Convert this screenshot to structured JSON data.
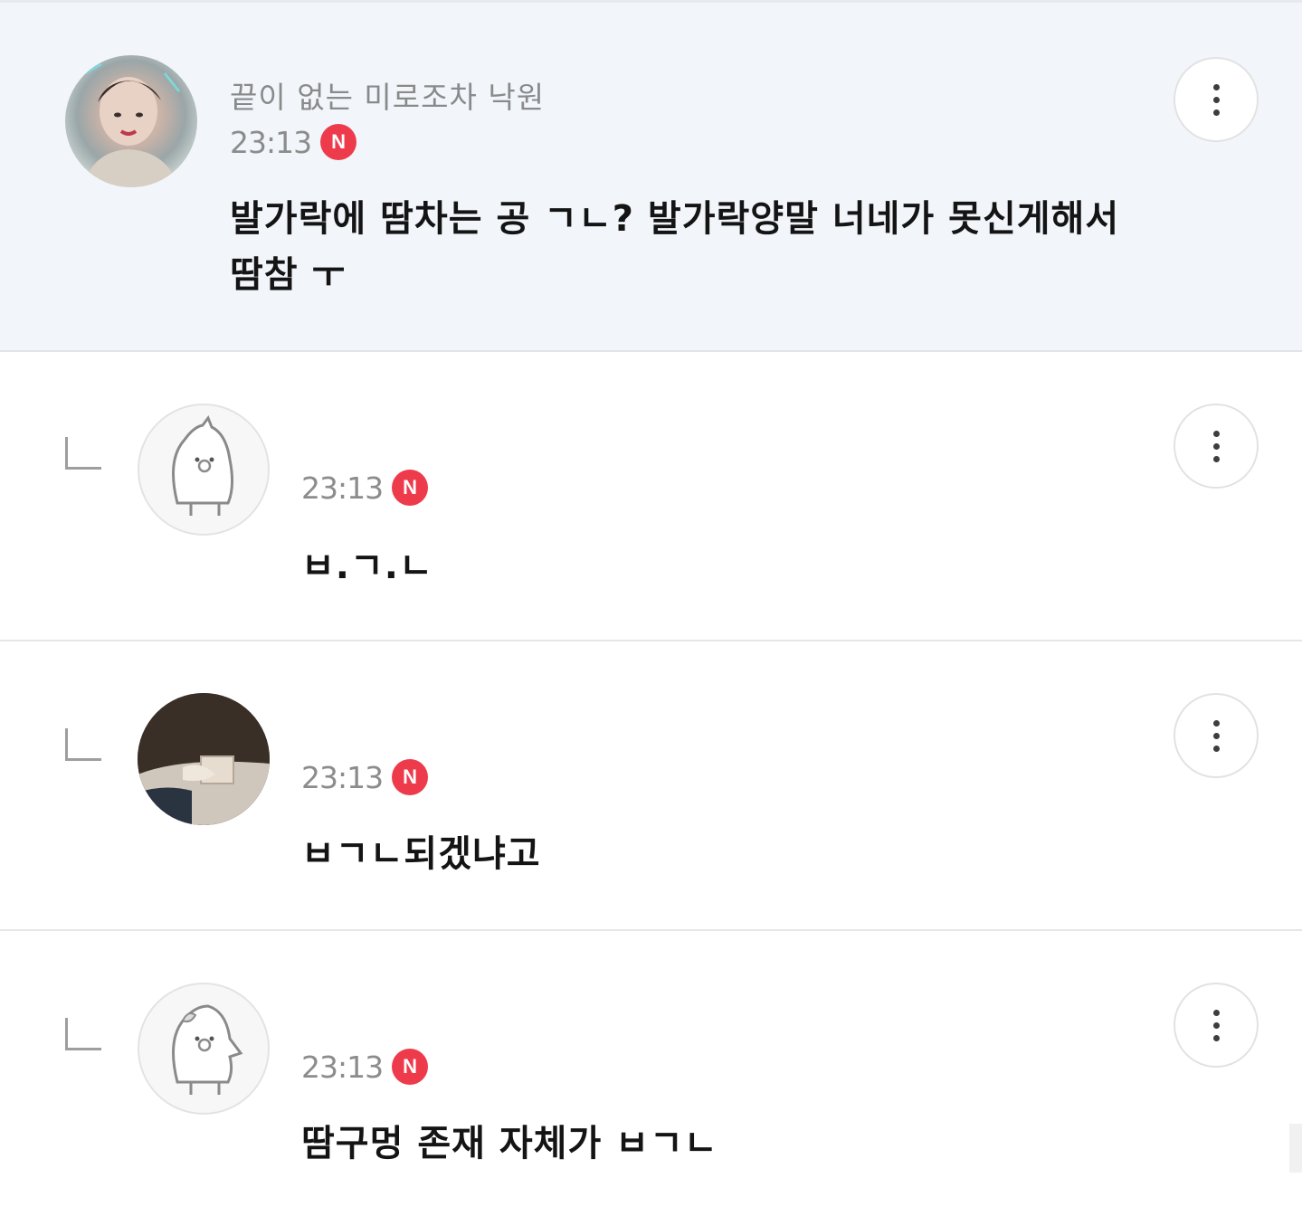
{
  "comments": [
    {
      "type": "main",
      "username": "끝이 없는 미로조차 낙원",
      "time": "23:13",
      "badge": "N",
      "text_lines": [
        "발가락에 땀차는 공 ㄱㄴ? 발가락양말 너네가 못신게해서",
        "땀참 ㅜ"
      ],
      "avatar_icon": "profile-photo-icon",
      "more_icon": "more-vertical-icon"
    },
    {
      "type": "reply",
      "username": "",
      "time": "23:13",
      "badge": "N",
      "text_lines": [
        "ㅂ.ㄱ.ㄴ"
      ],
      "avatar_icon": "default-penguin-avatar-icon",
      "more_icon": "more-vertical-icon"
    },
    {
      "type": "reply",
      "username": "",
      "time": "23:13",
      "badge": "N",
      "text_lines": [
        "ㅂㄱㄴ되겠냐고"
      ],
      "avatar_icon": "profile-photo-icon",
      "more_icon": "more-vertical-icon"
    },
    {
      "type": "reply",
      "username": "",
      "time": "23:13",
      "badge": "N",
      "text_lines": [
        "땀구멍 존재 자체가 ㅂㄱㄴ"
      ],
      "avatar_icon": "default-penguin-avatar-icon",
      "more_icon": "more-vertical-icon"
    }
  ],
  "colors": {
    "main_bg": "#f2f6fb",
    "badge": "#ee3b4b",
    "time": "#8c8c8c",
    "text": "#141414"
  }
}
